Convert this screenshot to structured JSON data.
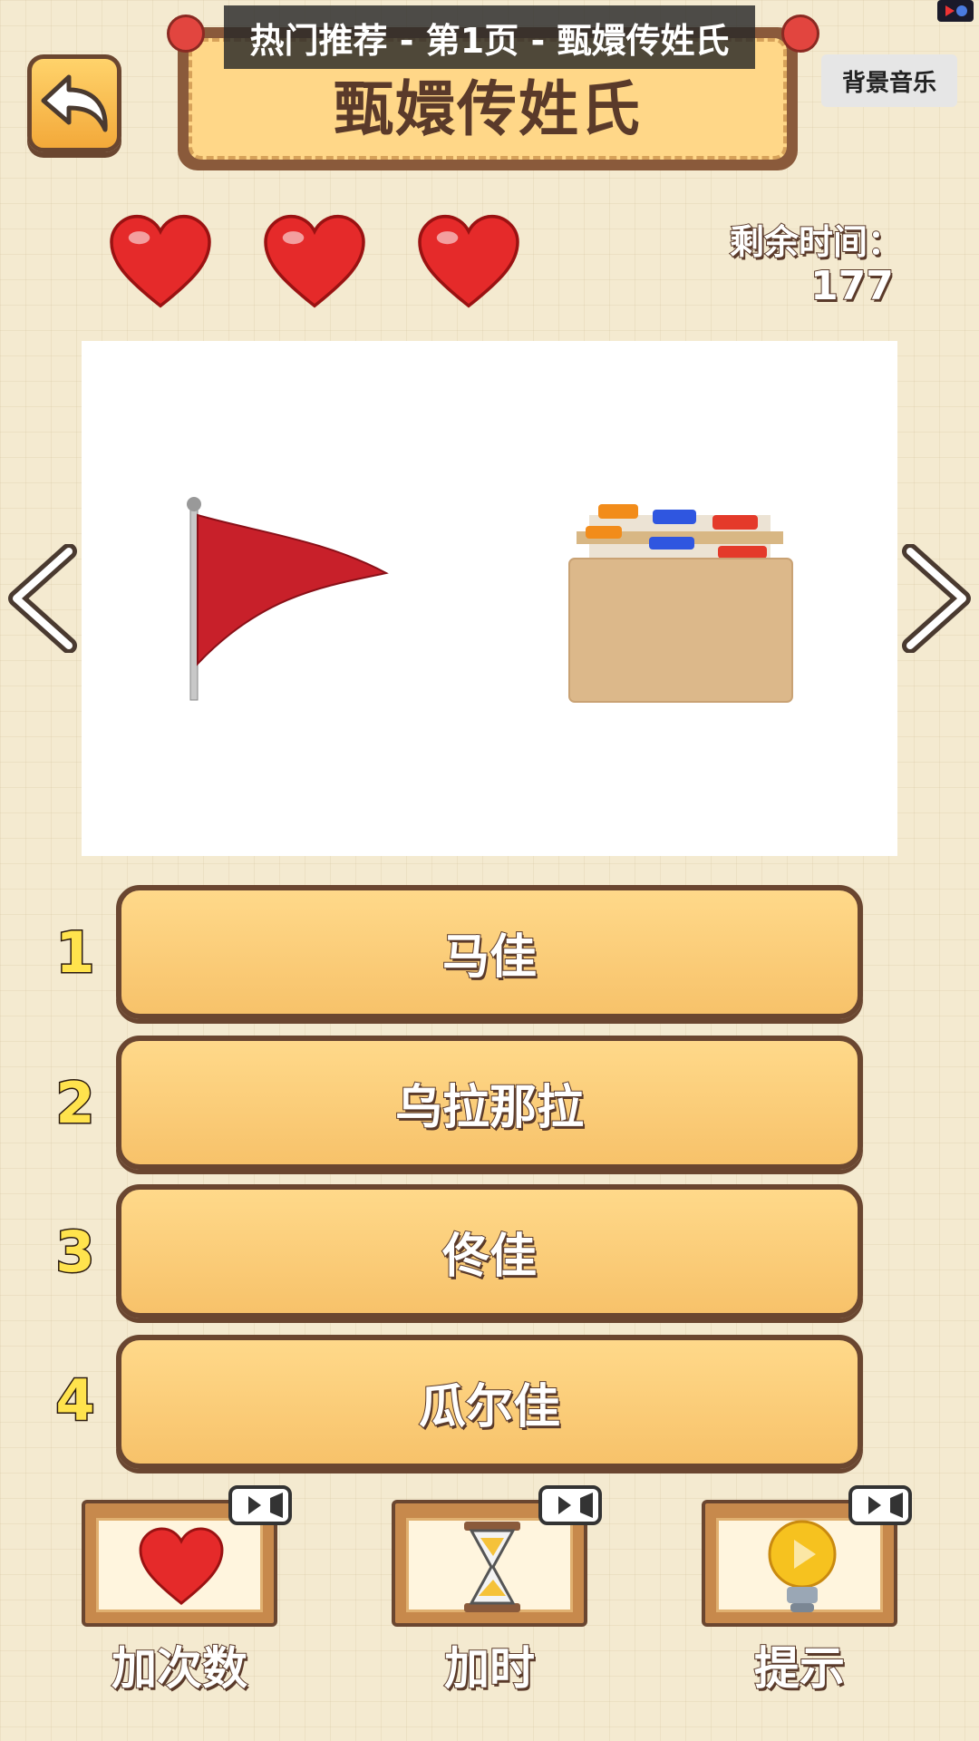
{
  "overlay": {
    "title": "热门推荐 - 第1页 - 甄嬛传姓氏"
  },
  "header": {
    "title": "甄嬛传姓氏",
    "music_label": "背景音乐"
  },
  "lives": {
    "count": 3,
    "icon": "heart-icon"
  },
  "timer": {
    "label": "剩余时间：",
    "value": "177"
  },
  "puzzle": {
    "images": [
      "red-flag-icon",
      "card-index-dividers-icon"
    ]
  },
  "options": [
    {
      "number": "1",
      "label": "马佳"
    },
    {
      "number": "2",
      "label": "乌拉那拉"
    },
    {
      "number": "3",
      "label": "佟佳"
    },
    {
      "number": "4",
      "label": "瓜尔佳"
    }
  ],
  "tools": [
    {
      "label": "加次数",
      "icon": "heart-icon"
    },
    {
      "label": "加时",
      "icon": "hourglass-icon"
    },
    {
      "label": "提示",
      "icon": "lightbulb-icon"
    }
  ],
  "colors": {
    "button_fill": "#f7c26a",
    "outline": "#6a4630",
    "number": "#ffe34d"
  }
}
